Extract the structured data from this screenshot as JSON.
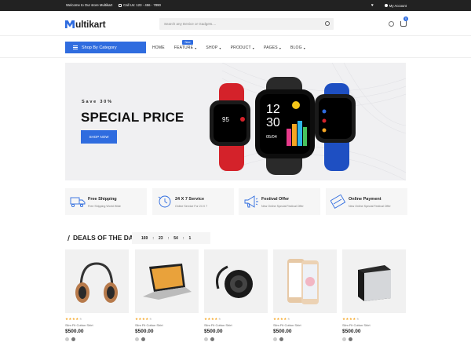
{
  "topbar": {
    "welcome": "Welcome to Our store Multikart",
    "call": "Call Us: 123 - 456 - 7890",
    "account": "My Account"
  },
  "header": {
    "logo_text": "ultikart",
    "search_placeholder": "Search any Device or Gadgets....",
    "cart_count": "0"
  },
  "nav": {
    "shop_by_category": "Shop By Category",
    "items": [
      "HOME",
      "FEATURE",
      "SHOP",
      "PRODUCT",
      "PAGES",
      "BLOG"
    ],
    "new_badge": "New"
  },
  "hero": {
    "save_text": "Save 30%",
    "title": "SPECIAL PRICE",
    "button": "SHOP NOW",
    "watch_time": "12",
    "watch_time2": "30",
    "watch_num": "95",
    "watch_date": "05/04"
  },
  "services": [
    {
      "title": "Free Shipping",
      "subtitle": "Free Shipping World Wide"
    },
    {
      "title": "24 X 7 Service",
      "subtitle": "Online Service For 24 X 7"
    },
    {
      "title": "Festival Offer",
      "subtitle": "New Online Special Festival Offer"
    },
    {
      "title": "Online Payment",
      "subtitle": "New Online Special Festival Offer"
    }
  ],
  "deals": {
    "title": "DEALS OF THE DAY",
    "timer": [
      "169",
      "23",
      "54",
      "1"
    ]
  },
  "products": [
    {
      "name": "Slim Fit Cotton Shirt",
      "price": "$500.00",
      "rating": 4
    },
    {
      "name": "Slim Fit Cotton Shirt",
      "price": "$500.00",
      "rating": 4
    },
    {
      "name": "Slim Fit Cotton Shirt",
      "price": "$500.00",
      "rating": 4
    },
    {
      "name": "Slim Fit Cotton Shirt",
      "price": "$500.00",
      "rating": 4
    },
    {
      "name": "Slim Fit Cotton Shirt",
      "price": "$500.00",
      "rating": 4
    }
  ],
  "colors": {
    "accent": "#2f6cdf",
    "topbar": "#222222",
    "star": "#f5a623"
  }
}
